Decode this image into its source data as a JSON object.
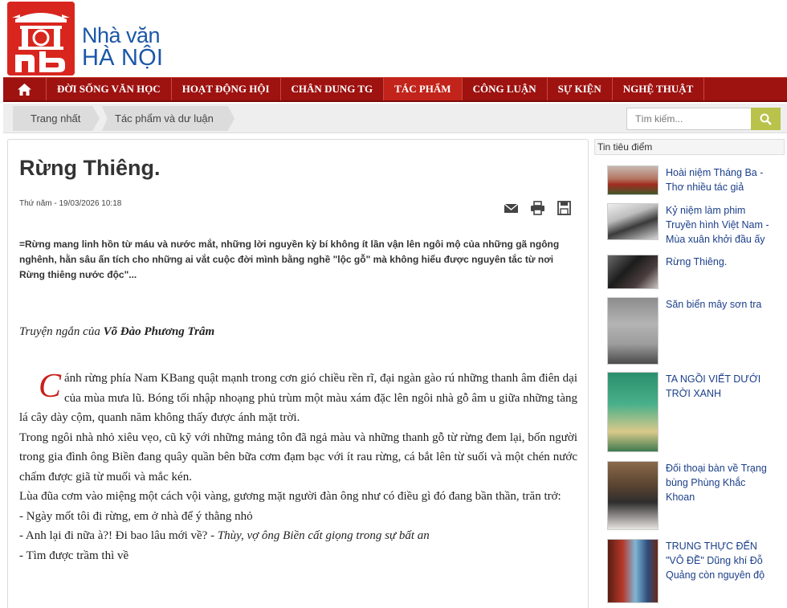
{
  "site": {
    "logo_line1": "Nhà văn",
    "logo_line2": "HÀ NỘI",
    "brand_color": "#d8261f",
    "logo_text_color": "#1a57a8"
  },
  "nav": {
    "home_icon": "home-icon",
    "items": [
      {
        "label": "ĐỜI SỐNG VĂN HỌC"
      },
      {
        "label": "HOẠT ĐỘNG HỘI"
      },
      {
        "label": "CHÂN DUNG TG"
      },
      {
        "label": "TÁC PHẨM",
        "active": true
      },
      {
        "label": "CÔNG LUẬN"
      },
      {
        "label": "SỰ KIỆN"
      },
      {
        "label": "NGHỆ THUẬT"
      }
    ],
    "bar_color": "#9e1210",
    "active_color": "#c2231a"
  },
  "breadcrumb": {
    "items": [
      {
        "label": "Trang nhất"
      },
      {
        "label": "Tác phẩm và dư luận"
      }
    ]
  },
  "search": {
    "placeholder": "Tìm kiếm...",
    "button_icon": "search-icon",
    "button_color": "#b9c24a"
  },
  "article": {
    "title": "Rừng Thiêng.",
    "date": "Thứ năm - 19/03/2026 10:18",
    "tools": [
      "email-icon",
      "print-icon",
      "save-icon"
    ],
    "lead": "=Rừng mang linh hồn từ máu và nước mắt, những lời nguyền kỳ bí không ít lần vận lên ngôi mộ của những gã ngông nghênh, hằn sâu ấn tích cho những ai vắt cuộc đời mình bằng nghề \"lộc gỗ\" mà không hiểu được nguyên tắc từ nơi Rừng thiêng nước độc\"...",
    "byline_prefix": "Truyện ngắn của ",
    "byline_author": "Võ Đào Phương Trâm",
    "dropcap": "C",
    "dropcap_color": "#c8201a",
    "para1": "ánh rừng phía Nam KBang quật mạnh trong cơn gió chiều rền rĩ, đại ngàn gào rú những thanh âm điên dại của mùa mưa lũ. Bóng tối nhập nhoạng phủ trùm một màu xám đặc lên ngôi nhà gỗ âm u giữa những tàng lá cây dày cộm, quanh năm không thấy được ánh mặt trời.",
    "para2": "Trong ngôi nhà nhỏ xiêu vẹo, cũ kỹ với những mảng tôn đã ngả màu và những thanh gỗ từ rừng đem lại, bốn người trong gia đình ông Biền đang quây quần bên bữa cơm đạm bạc với ít rau rừng, cá bắt lên từ suối và một chén nước chấm được giã từ muối và mắc kén.",
    "para3": "Lùa đũa cơm vào miệng một cách vội vàng, gương mặt người đàn ông như có điều gì đó đang bần thần, trăn trở:",
    "line1": "- Ngày mốt tôi đi rừng, em ở nhà để ý thằng nhỏ",
    "line2a": "- Anh lại đi nữa à?! Đi bao lâu mới về? - ",
    "line2b": "Thùy, vợ ông Biền cất giọng trong sự bất an",
    "line3": "- Tìm được trầm thì về"
  },
  "sidebar": {
    "heading": "Tin tiêu điểm",
    "items": [
      {
        "title": "Hoài niệm Tháng Ba - Thơ nhiều tác giả"
      },
      {
        "title": "Kỷ niệm làm phim Truyền hình Việt Nam - Mùa xuân khởi đầu ấy"
      },
      {
        "title": "Rừng Thiêng."
      },
      {
        "title": "Săn biển mây sơn tra"
      },
      {
        "title": "TA NGỒI VIẾT DƯỚI TRỜI XANH"
      },
      {
        "title": "Đối thoại bàn về Trạng bùng Phùng Khắc Khoan"
      },
      {
        "title": "TRUNG THỰC ĐẾN \"VÔ ĐỀ\" Dũng khí Đỗ Quảng còn nguyên độ"
      }
    ],
    "link_color": "#1b3f8a"
  }
}
